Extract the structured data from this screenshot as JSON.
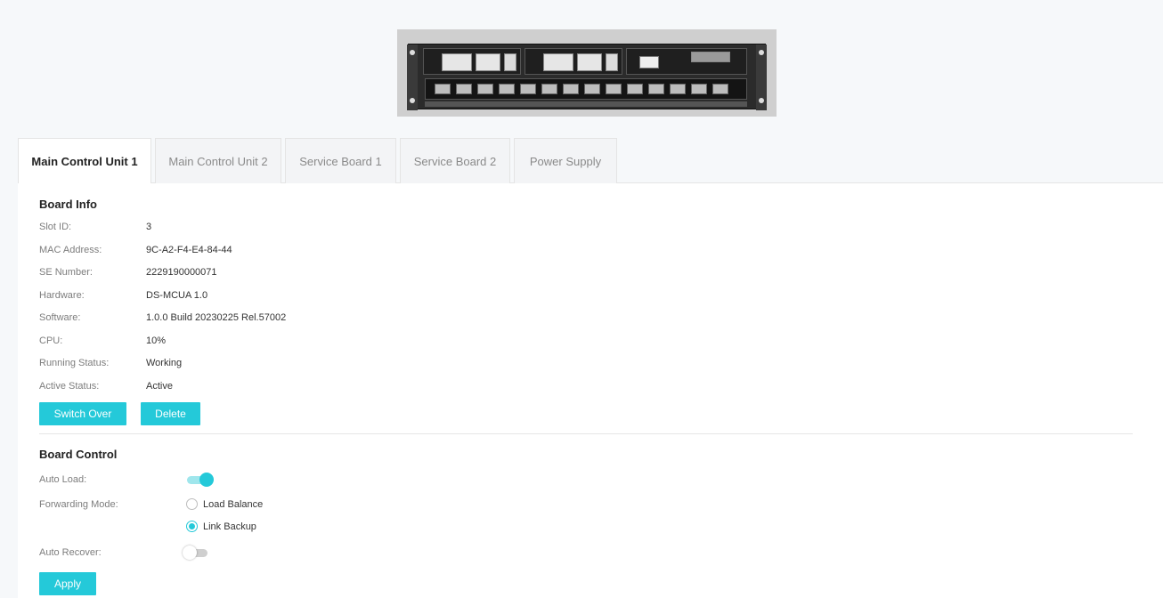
{
  "device": {
    "image_alt": "device-chassis-image"
  },
  "tabs": [
    {
      "label": "Main Control Unit 1",
      "active": true
    },
    {
      "label": "Main Control Unit 2",
      "active": false
    },
    {
      "label": "Service Board 1",
      "active": false
    },
    {
      "label": "Service Board 2",
      "active": false
    },
    {
      "label": "Power Supply",
      "active": false
    }
  ],
  "board_info": {
    "title": "Board Info",
    "rows": [
      {
        "label": "Slot ID:",
        "value": "3"
      },
      {
        "label": "MAC Address:",
        "value": "9C-A2-F4-E4-84-44"
      },
      {
        "label": "SE Number:",
        "value": "2229190000071"
      },
      {
        "label": "Hardware:",
        "value": "DS-MCUA 1.0"
      },
      {
        "label": "Software:",
        "value": "1.0.0 Build 20230225 Rel.57002"
      },
      {
        "label": "CPU:",
        "value": "10%"
      },
      {
        "label": "Running Status:",
        "value": "Working"
      },
      {
        "label": "Active Status:",
        "value": "Active"
      }
    ],
    "switch_over_label": "Switch Over",
    "delete_label": "Delete"
  },
  "board_control": {
    "title": "Board Control",
    "auto_load_label": "Auto Load:",
    "auto_load_on": true,
    "forwarding_mode_label": "Forwarding Mode:",
    "forwarding_options": [
      {
        "label": "Load Balance",
        "checked": false
      },
      {
        "label": "Link Backup",
        "checked": true
      }
    ],
    "auto_recover_label": "Auto Recover:",
    "auto_recover_on": false,
    "apply_label": "Apply"
  },
  "colors": {
    "accent": "#24c9d9",
    "page_bg": "#f6f8fa"
  }
}
